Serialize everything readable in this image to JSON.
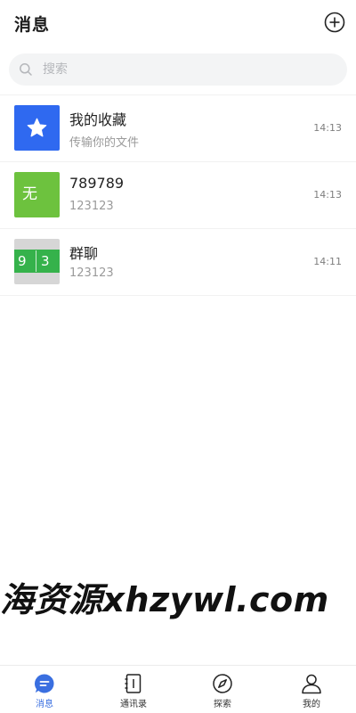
{
  "header": {
    "title": "消息"
  },
  "search": {
    "placeholder": "搜索"
  },
  "conversations": [
    {
      "name": "我的收藏",
      "subtitle": "传输你的文件",
      "time": "14:13",
      "avatar_type": "favorites-star",
      "avatar_color": "#2f69f0"
    },
    {
      "name": "789789",
      "subtitle": "123123",
      "time": "14:13",
      "avatar_type": "text",
      "avatar_text": "无",
      "avatar_color": "#6dc23e"
    },
    {
      "name": "群聊",
      "subtitle": "123123",
      "time": "14:11",
      "avatar_type": "group-collage",
      "avatar_digits": [
        "9",
        "3"
      ],
      "avatar_color": "#35b24b"
    }
  ],
  "watermark": "海资源xhzywl.com",
  "tabbar": {
    "active": "messages",
    "accent_color": "#3a6fe0",
    "tabs": [
      {
        "key": "messages",
        "label": "消息",
        "icon": "chat-bubble-icon"
      },
      {
        "key": "contacts",
        "label": "通讯录",
        "icon": "address-book-icon"
      },
      {
        "key": "explore",
        "label": "探索",
        "icon": "compass-icon"
      },
      {
        "key": "me",
        "label": "我的",
        "icon": "person-icon"
      }
    ]
  }
}
